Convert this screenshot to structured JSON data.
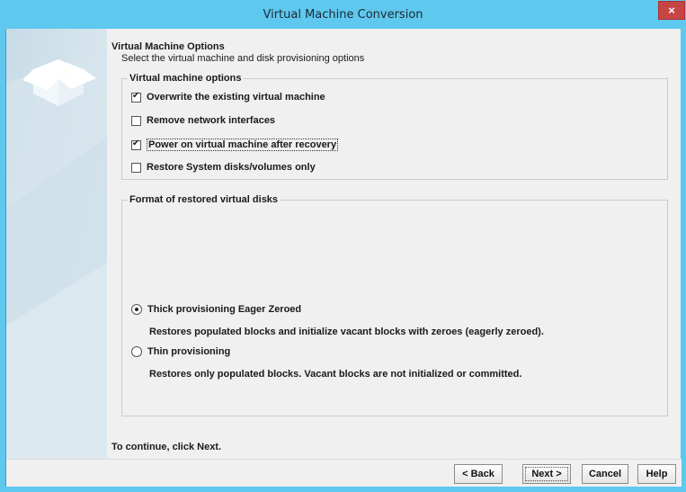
{
  "window": {
    "title": "Virtual Machine Conversion",
    "close_label": "×"
  },
  "header": {
    "title": "Virtual Machine Options",
    "subtitle": "Select the virtual machine and disk provisioning options"
  },
  "vm_options": {
    "label": "Virtual machine options",
    "items": [
      {
        "label": "Overwrite the existing virtual machine",
        "checked": true
      },
      {
        "label": "Remove network interfaces",
        "checked": false
      },
      {
        "label": "Power on virtual machine after recovery",
        "checked": true
      },
      {
        "label": "Restore System disks/volumes only",
        "checked": false
      }
    ]
  },
  "disk_format": {
    "label": "Format of restored virtual disks",
    "options": [
      {
        "label": "Thick provisioning Eager Zeroed",
        "selected": true,
        "description": "Restores populated blocks and initialize vacant blocks with zeroes (eagerly zeroed)."
      },
      {
        "label": "Thin provisioning",
        "selected": false,
        "description": "Restores only populated blocks. Vacant blocks are not initialized or committed."
      }
    ]
  },
  "footer_hint": "To continue, click Next.",
  "buttons": {
    "back": "< Back",
    "next": "Next >",
    "cancel": "Cancel",
    "help": "Help"
  },
  "colors": {
    "titlebar": "#5fc8ee",
    "close": "#c74545",
    "background": "#f0f0f0"
  }
}
